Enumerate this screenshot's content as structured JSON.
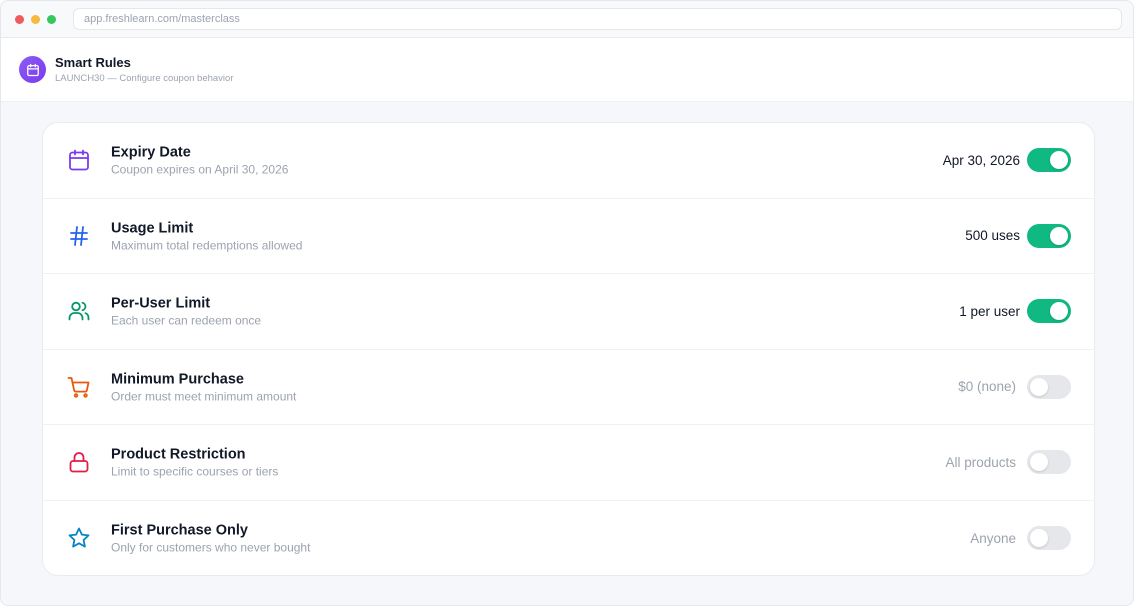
{
  "browser": {
    "url": "app.freshlearn.com/masterclass"
  },
  "header": {
    "title": "Smart Rules",
    "subtitle": "LAUNCH30 — Configure coupon behavior",
    "icon": "calendar-icon",
    "icon_color": "#7c3aed"
  },
  "rules": [
    {
      "title": "Expiry Date",
      "description": "Coupon expires on April 30, 2026",
      "value": "Apr 30, 2026",
      "enabled": true,
      "icon": "calendar-icon",
      "icon_color": "#7c3aed"
    },
    {
      "title": "Usage Limit",
      "description": "Maximum total redemptions allowed",
      "value": "500 uses",
      "enabled": true,
      "icon": "hash-icon",
      "icon_color": "#2563eb"
    },
    {
      "title": "Per-User Limit",
      "description": "Each user can redeem once",
      "value": "1 per user",
      "enabled": true,
      "icon": "users-icon",
      "icon_color": "#059669"
    },
    {
      "title": "Minimum Purchase",
      "description": "Order must meet minimum amount",
      "value": "$0 (none)",
      "enabled": false,
      "icon": "cart-icon",
      "icon_color": "#ea580c"
    },
    {
      "title": "Product Restriction",
      "description": "Limit to specific courses or tiers",
      "value": "All products",
      "enabled": false,
      "icon": "lock-icon",
      "icon_color": "#e11d48"
    },
    {
      "title": "First Purchase Only",
      "description": "Only for customers who never bought",
      "value": "Anyone",
      "enabled": false,
      "icon": "star-icon",
      "icon_color": "#0284c7"
    }
  ],
  "colors": {
    "toggle_on": "#10b981",
    "toggle_off": "#e5e7eb",
    "accent": "#7c3aed"
  }
}
